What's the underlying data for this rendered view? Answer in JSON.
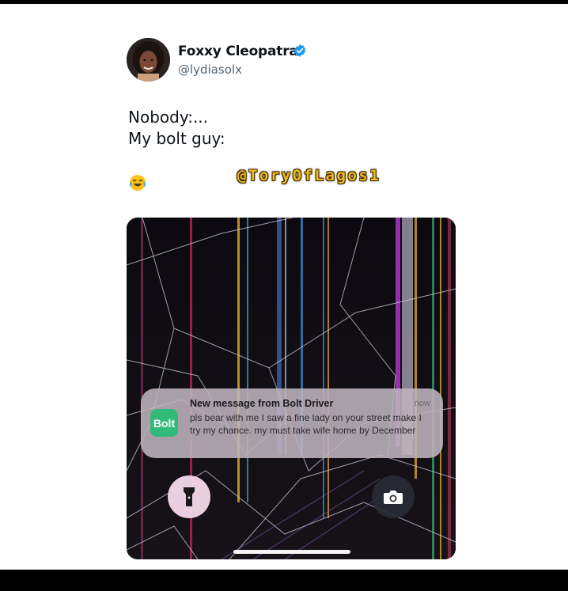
{
  "tweet": {
    "author_name": "Foxxy Cleopatra",
    "handle": "@lydiasolx",
    "lines": [
      "Nobody:...",
      "My bolt guy:"
    ],
    "emoji": "face-with-tears-of-joy-icon",
    "watermark": "@ToryOfLagos1"
  },
  "phone": {
    "notification": {
      "app_icon_label": "Bolt",
      "title": "New message from Bolt Driver",
      "time": "now",
      "body": "pls bear with me I saw a fine lady on your street make I try my chance. my must take wife home by December"
    },
    "flashlight_icon": "flashlight-icon",
    "camera_icon": "camera-icon"
  },
  "colors": {
    "verified": "#1d9bf0",
    "bolt_green": "#32bb78",
    "watermark": "#f2b81c"
  }
}
